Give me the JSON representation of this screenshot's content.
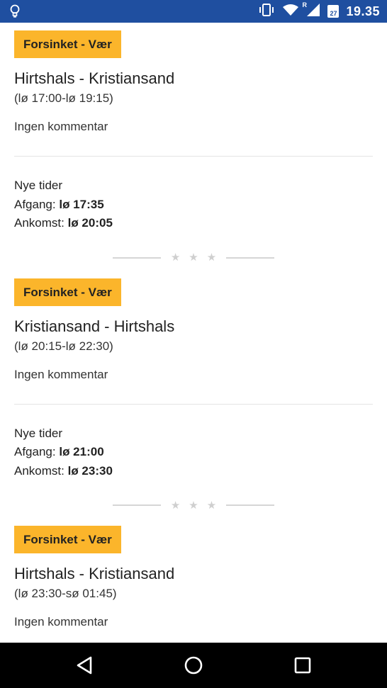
{
  "status_bar": {
    "time": "19.35",
    "calendar_day": "27",
    "network_label": "R"
  },
  "notices": [
    {
      "badge": "Forsinket - Vær",
      "route": "Hirtshals - Kristiansand",
      "times": "(lø 17:00-lø 19:15)",
      "comment": "Ingen kommentar",
      "new_times_label": "Nye tider",
      "departure_label": "Afgang:",
      "departure_value": "lø 17:35",
      "arrival_label": "Ankomst:",
      "arrival_value": "lø 20:05"
    },
    {
      "badge": "Forsinket - Vær",
      "route": "Kristiansand - Hirtshals",
      "times": "(lø 20:15-lø 22:30)",
      "comment": "Ingen kommentar",
      "new_times_label": "Nye tider",
      "departure_label": "Afgang:",
      "departure_value": "lø 21:00",
      "arrival_label": "Ankomst:",
      "arrival_value": "lø 23:30"
    },
    {
      "badge": "Forsinket - Vær",
      "route": "Hirtshals - Kristiansand",
      "times": "(lø 23:30-sø 01:45)",
      "comment": "Ingen kommentar"
    }
  ],
  "icons": {
    "status_left": "lightbulb-icon",
    "vibrate": "vibrate-icon",
    "wifi": "wifi-icon",
    "signal": "signal-icon",
    "calendar": "calendar-icon",
    "nav_back": "back-triangle-icon",
    "nav_home": "home-circle-icon",
    "nav_recents": "recents-square-icon"
  },
  "colors": {
    "status_bar": "#1f4fa0",
    "badge": "#fbb52b",
    "nav_bar": "#000000"
  }
}
